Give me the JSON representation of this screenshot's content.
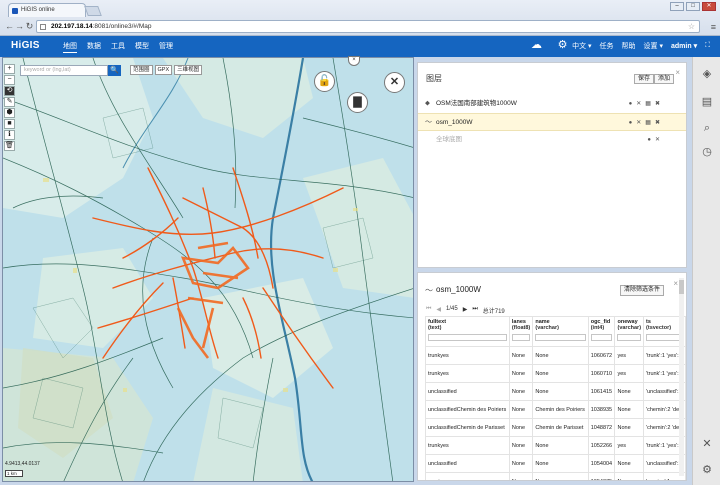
{
  "browser": {
    "tab_title": "HiGIS online",
    "url_prefix": "202.197.18.14",
    "url_rest": ":8081/online3/#/Map",
    "buttons": {
      "back": "←",
      "forward": "→",
      "reload": "↻",
      "menu": "≡",
      "star": "☆"
    }
  },
  "app": {
    "logo": "HiGIS",
    "nav": [
      "地图",
      "数据",
      "工具",
      "模型",
      "管理"
    ],
    "active_nav": "地图",
    "right_nav": [
      "中文 ▾",
      "任务",
      "帮助",
      "设置 ▾",
      "admin ▾"
    ]
  },
  "map": {
    "search_placeholder": "keyword or (lng,lat)",
    "tools": [
      "范围圈",
      "GPX",
      "三维视图"
    ],
    "controls": [
      "+",
      "−",
      "⟲",
      "✎",
      "⬢",
      "■",
      "ℹ",
      "🗑"
    ],
    "coordinates": "4.9413,44.0137",
    "scale": "1 km",
    "colors": {
      "water": "#b9dbe6",
      "land": "#d7ebe7",
      "roads": "#1f5a4a",
      "highlight": "#f05a1a"
    }
  },
  "layers_panel": {
    "title": "图层",
    "save": "保存",
    "add": "添加",
    "close": "×",
    "layers": [
      {
        "name": "OSM法国南部建筑物1000W",
        "icon": "poi-icon",
        "selected": false
      },
      {
        "name": "osm_1000W",
        "icon": "line-icon",
        "selected": true
      },
      {
        "name": "全球底图",
        "icon": "",
        "selected": false
      }
    ]
  },
  "attribute_table": {
    "title": "osm_1000W",
    "clear_filter": "清除筛选条件",
    "close": "×",
    "pager": {
      "page": "1/45",
      "total": "总计719"
    },
    "columns": [
      {
        "name": "fulltext",
        "type": "(text)"
      },
      {
        "name": "lanes",
        "type": "(float8)"
      },
      {
        "name": "name",
        "type": "(varchar)"
      },
      {
        "name": "ogc_fid",
        "type": "(int4)"
      },
      {
        "name": "oneway",
        "type": "(varchar)"
      },
      {
        "name": "ts",
        "type": "(tsvector)"
      }
    ],
    "rows": [
      [
        "trunkyes",
        "None",
        "None",
        "1060672",
        "yes",
        "'trunk':1 'yes':2"
      ],
      [
        "trunkyes",
        "None",
        "None",
        "1060710",
        "yes",
        "'trunk':1 'yes':2"
      ],
      [
        "unclassified",
        "None",
        "None",
        "1061415",
        "None",
        "'unclassified':1"
      ],
      [
        "unclassifiedChemin des Poiriers",
        "None",
        "Chemin des Poiriers",
        "1038935",
        "None",
        "'chemin':2 'des'"
      ],
      [
        "unclassifiedChemin de Parisset",
        "None",
        "Chemin de Parisset",
        "1048872",
        "None",
        "'chemin':2 'de':"
      ],
      [
        "trunkyes",
        "None",
        "None",
        "1052266",
        "yes",
        "'trunk':1 'yes':2"
      ],
      [
        "unclassified",
        "None",
        "None",
        "1054004",
        "None",
        "'unclassified':1"
      ],
      [
        "service",
        "None",
        "None",
        "1054375",
        "None",
        "'service':1"
      ]
    ]
  }
}
